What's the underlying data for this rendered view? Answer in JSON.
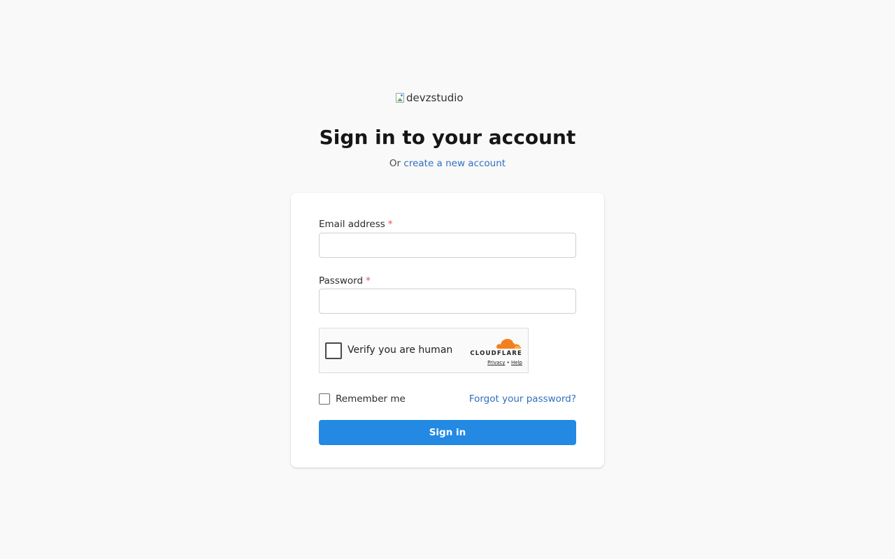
{
  "logo": {
    "alt_text": "devzstudio",
    "icon": "broken-image-icon"
  },
  "header": {
    "title": "Sign in to your account",
    "subtitle_prefix": "Or",
    "create_account_link": "create a new account"
  },
  "form": {
    "email": {
      "label": "Email address",
      "required_mark": "*",
      "value": ""
    },
    "password": {
      "label": "Password",
      "required_mark": "*",
      "value": ""
    },
    "captcha": {
      "label": "Verify you are human",
      "brand": "CLOUDFLARE",
      "privacy_link": "Privacy",
      "separator": "•",
      "help_link": "Help"
    },
    "remember_label": "Remember me",
    "forgot_link": "Forgot your password?",
    "submit_label": "Sign in"
  },
  "colors": {
    "background": "#f9f9f9",
    "link": "#2f6fbf",
    "primary_button": "#2389e3",
    "required": "#e05252",
    "cloudflare_orange": "#f38020"
  }
}
